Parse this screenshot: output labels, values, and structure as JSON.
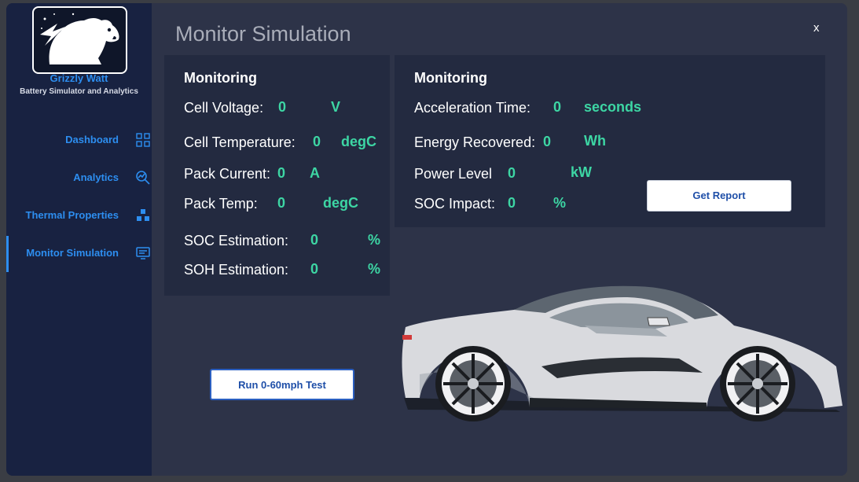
{
  "app": {
    "name": "Grizzly Watt",
    "subtitle": "Battery Simulator and Analytics",
    "close_label": "x"
  },
  "colors": {
    "accent": "#2d8ef0",
    "value": "#3dd6a4",
    "sidebar_bg": "#182241",
    "panel_bg": "#232a40",
    "window_bg": "#2d3348"
  },
  "sidebar": {
    "items": [
      {
        "label": "Dashboard",
        "icon": "grid-icon"
      },
      {
        "label": "Analytics",
        "icon": "analytics-icon"
      },
      {
        "label": "Thermal Properties",
        "icon": "thermal-icon"
      },
      {
        "label": "Monitor Simulation",
        "icon": "monitor-icon",
        "active": true
      }
    ]
  },
  "page": {
    "title": "Monitor Simulation"
  },
  "left_panel": {
    "heading": "Monitoring",
    "cell_voltage": {
      "label": "Cell Voltage:",
      "value": "0",
      "unit": "V"
    },
    "cell_temperature": {
      "label": "Cell Temperature:",
      "value": "0",
      "unit": "degC"
    },
    "pack_current": {
      "label": "Pack Current:",
      "value": "0",
      "unit": "A"
    },
    "pack_temp": {
      "label": "Pack Temp:",
      "value": "0",
      "unit": "degC"
    },
    "soc_estimation": {
      "label": "SOC Estimation:",
      "value": "0",
      "unit": "%"
    },
    "soh_estimation": {
      "label": "SOH Estimation:",
      "value": "0",
      "unit": "%"
    }
  },
  "right_panel": {
    "heading": "Monitoring",
    "acceleration_time": {
      "label": "Acceleration Time:",
      "value": "0",
      "unit": "seconds"
    },
    "energy_recovered": {
      "label": "Energy Recovered:",
      "value": "0",
      "unit": "Wh"
    },
    "power_level": {
      "label": "Power Level",
      "value": "0",
      "unit": "kW"
    },
    "soc_impact": {
      "label": "SOC Impact:",
      "value": "0",
      "unit": "%"
    }
  },
  "buttons": {
    "get_report": "Get Report",
    "run_test": "Run 0-60mph Test"
  },
  "images": {
    "logo": "grizzly-bear-logo",
    "car": "sports-car-illustration"
  }
}
